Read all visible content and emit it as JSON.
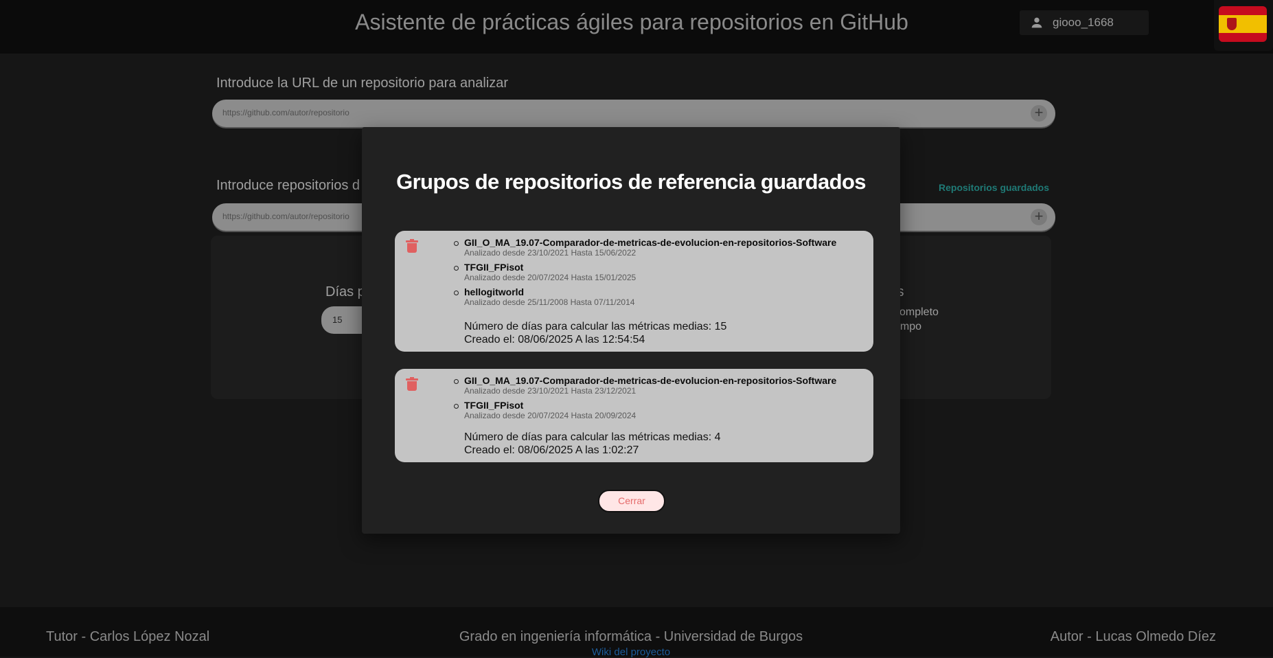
{
  "header": {
    "title": "Asistente de prácticas ágiles para repositorios en GitHub",
    "username": "giooo_1668",
    "user_icon": "person-icon",
    "language_flag": "spain-flag-icon"
  },
  "form": {
    "url_label": "Introduce la URL de un repositorio para analizar",
    "url_placeholder": "https://github.com/autor/repositorio",
    "ref_label": "Introduce repositorios d",
    "ref_placeholder": "https://github.com/autor/repositorio",
    "saved_link": "Repositorios guardados",
    "days_label": "Días p",
    "days_value": "15",
    "right_title": "is",
    "right_line1": "completo",
    "right_line2": "empo"
  },
  "modal": {
    "title": "Grupos de repositorios de referencia guardados",
    "groups": [
      {
        "repos": [
          {
            "name": "GII_O_MA_19.07-Comparador-de-metricas-de-evolucion-en-repositorios-Software",
            "range": "Analizado desde 23/10/2021 Hasta 15/06/2022"
          },
          {
            "name": "TFGII_FPisot",
            "range": "Analizado desde 20/07/2024 Hasta 15/01/2025"
          },
          {
            "name": "hellogitworld",
            "range": "Analizado desde 25/11/2008 Hasta 07/11/2014"
          }
        ],
        "days": "Número de días para calcular las métricas medias: 15",
        "created": "Creado el: 08/06/2025 A las 12:54:54"
      },
      {
        "repos": [
          {
            "name": "GII_O_MA_19.07-Comparador-de-metricas-de-evolucion-en-repositorios-Software",
            "range": "Analizado desde 23/10/2021 Hasta 23/12/2021"
          },
          {
            "name": "TFGII_FPisot",
            "range": "Analizado desde 20/07/2024 Hasta 20/09/2024"
          }
        ],
        "days": "Número de días para calcular las métricas medias: 4",
        "created": "Creado el: 08/06/2025 A las 1:02:27"
      }
    ],
    "close_label": "Cerrar"
  },
  "footer": {
    "tutor": "Tutor - Carlos López Nozal",
    "degree": "Grado en ingeniería informática - Universidad de Burgos",
    "author": "Autor - Lucas Olmedo Díez",
    "wiki": "Wiki del proyecto"
  },
  "colors": {
    "accent_link": "#1f7a76",
    "delete": "#e06060",
    "close_text": "#e56b6b"
  }
}
